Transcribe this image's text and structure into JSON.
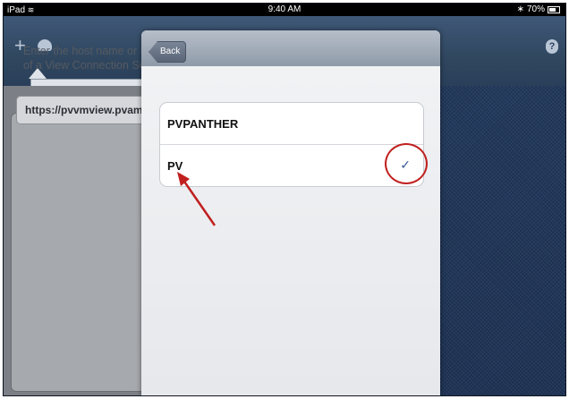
{
  "status_bar": {
    "device": "iPad",
    "time": "9:40 AM",
    "battery": "70%"
  },
  "nav": {
    "add_icon": "plus-icon",
    "cloud_icon": "cloud-icon",
    "help_icon": "help-icon",
    "help_label": "?"
  },
  "left_panel": {
    "prompt": "Enter the host name or IP\nof a View Connection Ser",
    "url_value": "https://pvvmview.pvamu."
  },
  "popover": {
    "back_label": "Back",
    "items": [
      {
        "label": "PVPANTHER",
        "selected": false
      },
      {
        "label": "PV",
        "selected": true
      }
    ],
    "check_glyph": "✓"
  },
  "annotation_color": "#c0201f"
}
